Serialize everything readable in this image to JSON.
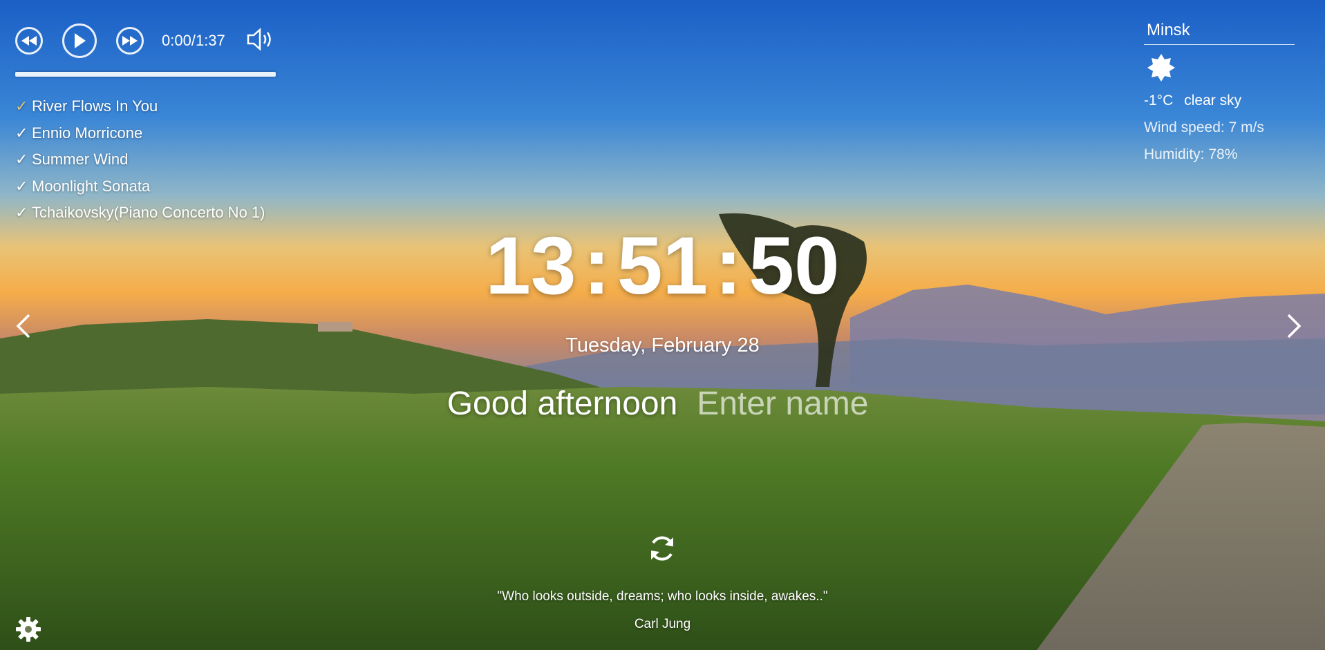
{
  "background": {
    "sky_top": "#1e62c4",
    "horizon": "#f3b14a",
    "grass": "#3f6b22"
  },
  "player": {
    "time_current": "0:00",
    "time_total": "1:37",
    "playlist": [
      {
        "title": "River Flows In You",
        "active": true
      },
      {
        "title": "Ennio Morricone"
      },
      {
        "title": "Summer Wind"
      },
      {
        "title": "Moonlight Sonata"
      },
      {
        "title": "Tchaikovsky(Piano Concerto No 1)"
      }
    ]
  },
  "weather": {
    "city": "Minsk",
    "icon": "sun-icon",
    "temperature": "-1°C",
    "description": "clear sky",
    "wind": "Wind speed: 7 m/s",
    "humidity": "Humidity: 78%"
  },
  "clock": {
    "hours": "13",
    "minutes": "51",
    "seconds": "50"
  },
  "date": "Tuesday, February 28",
  "greeting": {
    "text": "Good afternoon",
    "name_placeholder": "Enter name"
  },
  "quote": {
    "text": "\"Who looks outside, dreams; who looks inside, awakes..\"",
    "author": "Carl Jung"
  }
}
